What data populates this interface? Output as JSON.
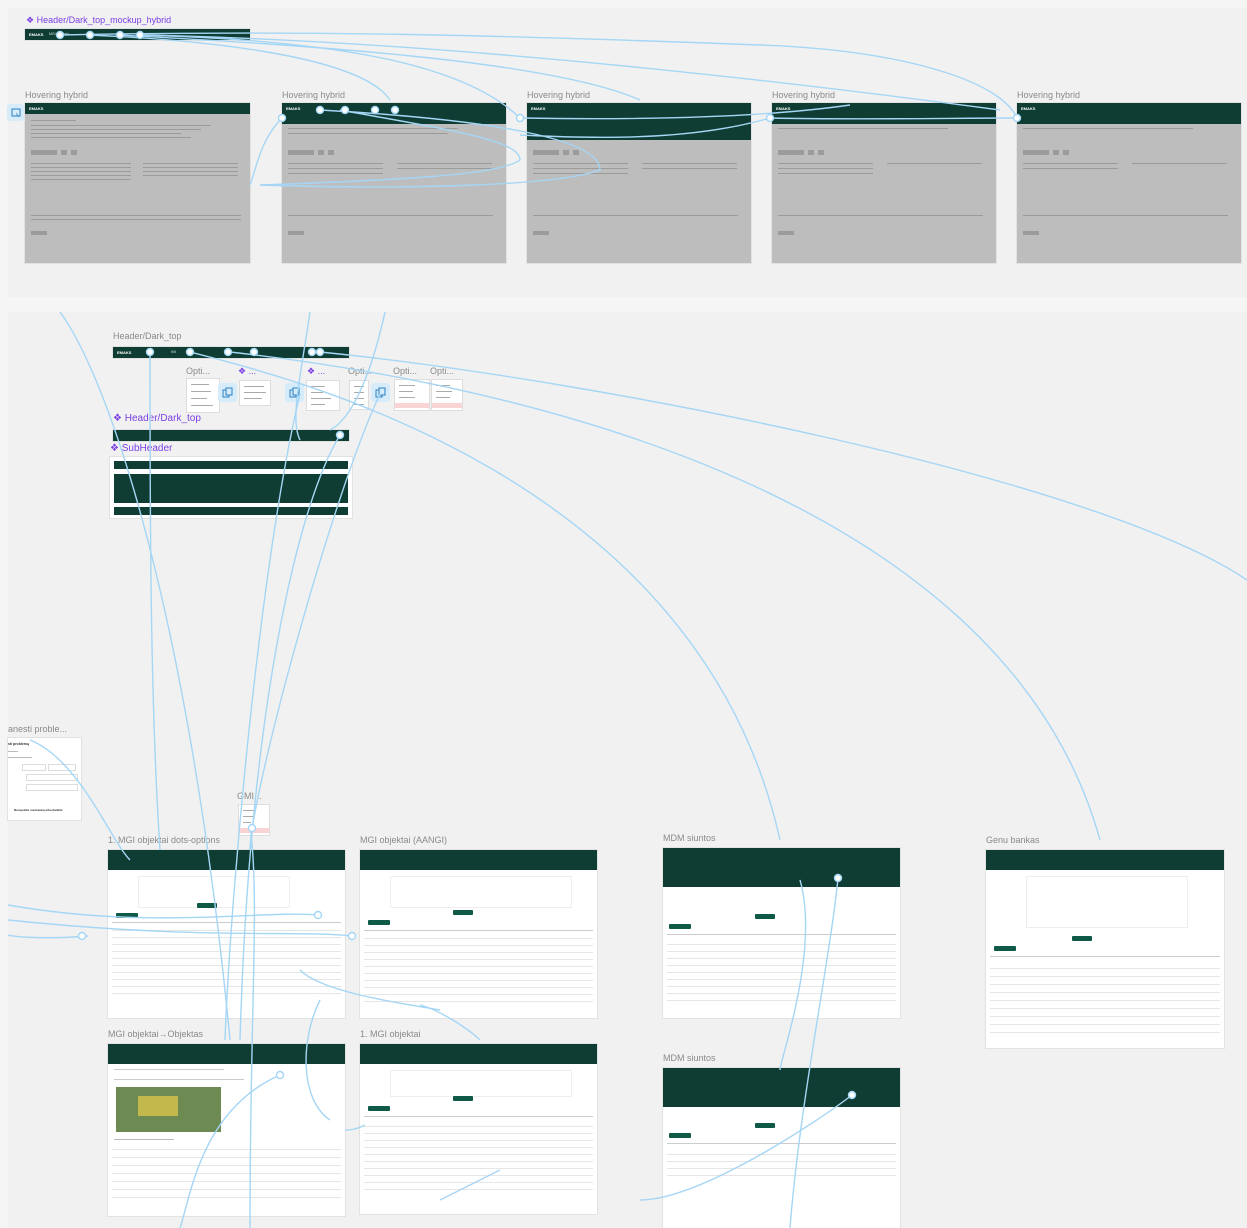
{
  "canvas": {
    "components": {
      "header_mockup": "Header/Dark_top_mockup_hybrid",
      "header_dark_top": "Header/Dark_top",
      "header_dark_top_2": "Header/Dark_top",
      "subheader": "SubHeader"
    },
    "hover_frames": [
      "Hovering hybrid",
      "Hovering hybrid",
      "Hovering hybrid",
      "Hovering hybrid",
      "Hovering hybrid"
    ],
    "options_labels": [
      "Opti...",
      "Opti...",
      "Opti...",
      "Opti..."
    ],
    "gmi_label": "GMI...",
    "report_frame": {
      "title": "anesti proble...",
      "heading": "sti problemą",
      "footer": "Nusiųskite nuotrauką arba įkelkite"
    },
    "screen_titles": {
      "mgi_dots": "1. MGI objektai dots-options",
      "mgi_aangi": "MGI objektai (AANGI)",
      "mdm_1": "MDM siuntos",
      "genu_bankas": "Genu bankas",
      "mgi_objektas": "MGI objektai→Objektas",
      "mgi_1": "1. MGI objektai",
      "mdm_2": "MDM siuntos"
    },
    "ellipsis": "..."
  }
}
